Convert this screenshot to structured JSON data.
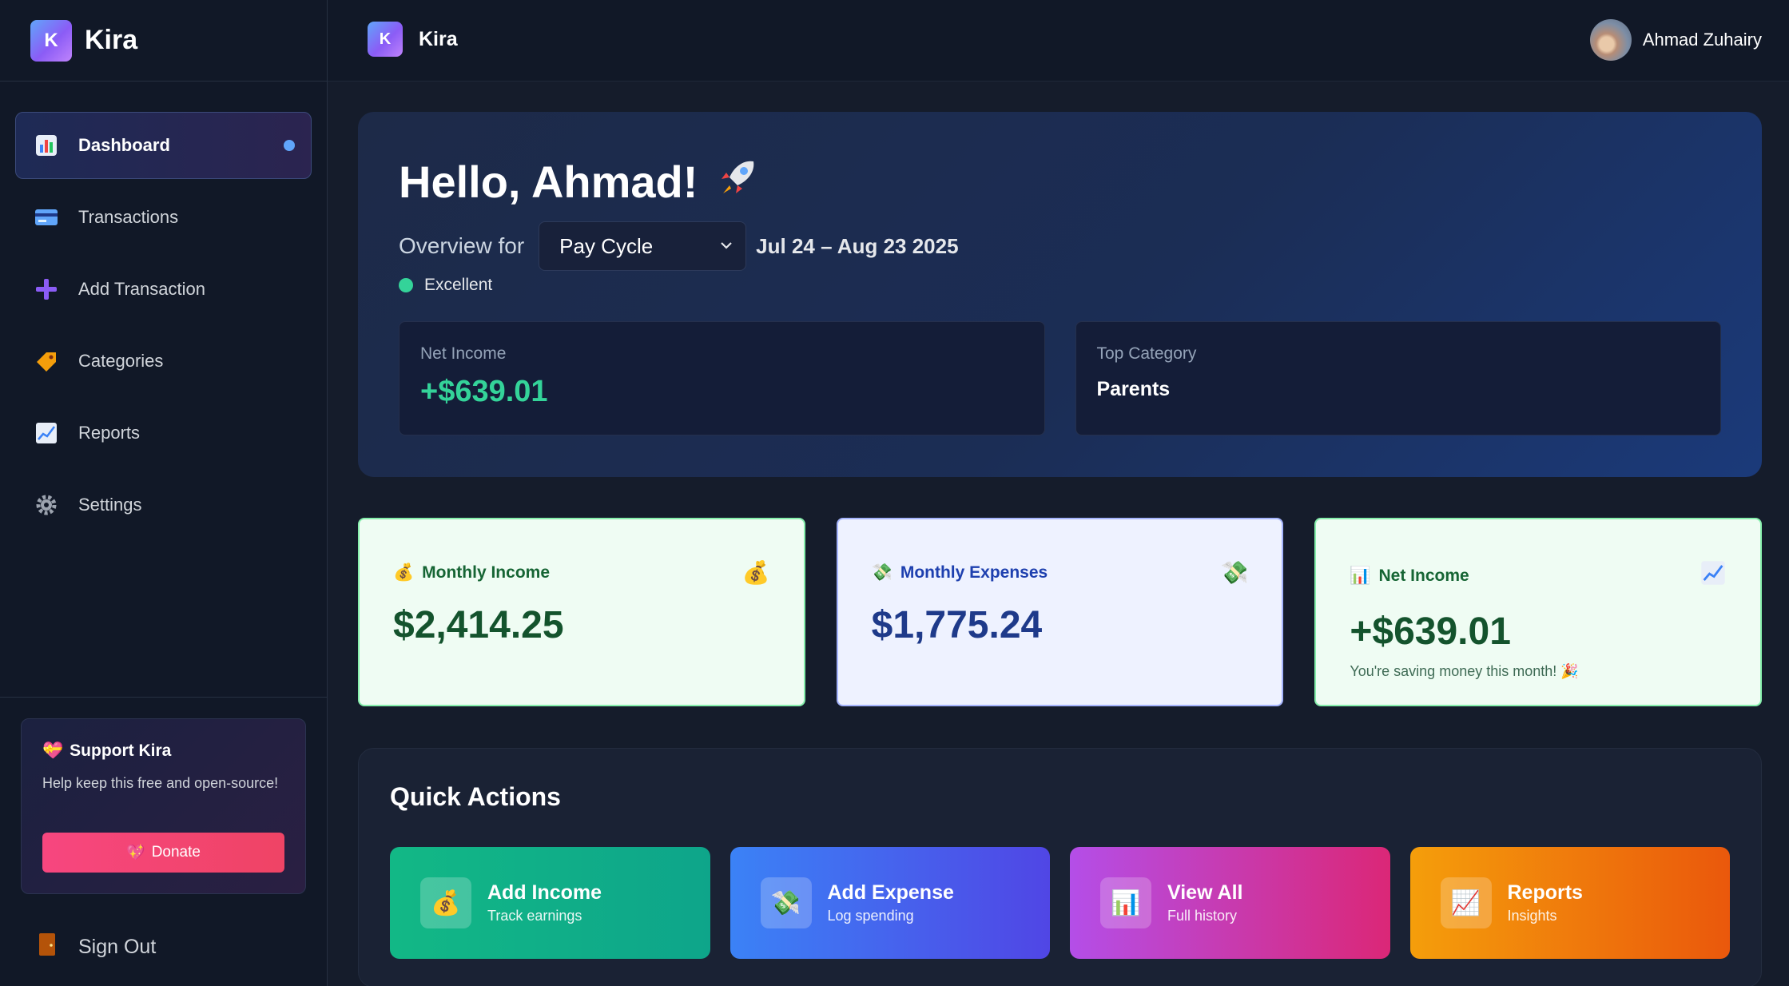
{
  "app": {
    "name": "Kira",
    "logo_letter": "K"
  },
  "sidebar": {
    "items": [
      {
        "label": "Dashboard",
        "icon": "bar-chart-icon",
        "active": true
      },
      {
        "label": "Transactions",
        "icon": "credit-card-icon"
      },
      {
        "label": "Add Transaction",
        "icon": "plus-icon"
      },
      {
        "label": "Categories",
        "icon": "tag-icon"
      },
      {
        "label": "Reports",
        "icon": "trend-chart-icon"
      },
      {
        "label": "Settings",
        "icon": "gear-icon"
      }
    ],
    "support": {
      "title": "Support Kira",
      "text": "Help keep this free and open-source!",
      "donate_label": "Donate"
    },
    "sign_out_label": "Sign Out"
  },
  "topbar": {
    "brand": "Kira",
    "user_name": "Ahmad Zuhairy"
  },
  "hero": {
    "title": "Hello, Ahmad!",
    "overview_label": "Overview for",
    "period_select": "Pay Cycle",
    "date_range": "Jul 24 – Aug 23 2025",
    "status": "Excellent",
    "net_income_label": "Net Income",
    "net_income_value": "+$639.01",
    "top_category_label": "Top Category",
    "top_category_value": "Parents"
  },
  "stats": {
    "income": {
      "title": "Monthly Income",
      "value": "$2,414.25"
    },
    "expenses": {
      "title": "Monthly Expenses",
      "value": "$1,775.24"
    },
    "net": {
      "title": "Net Income",
      "value": "+$639.01",
      "note": "You're saving money this month! 🎉"
    }
  },
  "quick_actions": {
    "title": "Quick Actions",
    "items": [
      {
        "title": "Add Income",
        "sub": "Track earnings"
      },
      {
        "title": "Add Expense",
        "sub": "Log spending"
      },
      {
        "title": "View All",
        "sub": "Full history"
      },
      {
        "title": "Reports",
        "sub": "Insights"
      }
    ]
  },
  "colors": {
    "accent_green": "#34d399",
    "accent_blue": "#60a5fa",
    "donate": "#f7467f"
  }
}
